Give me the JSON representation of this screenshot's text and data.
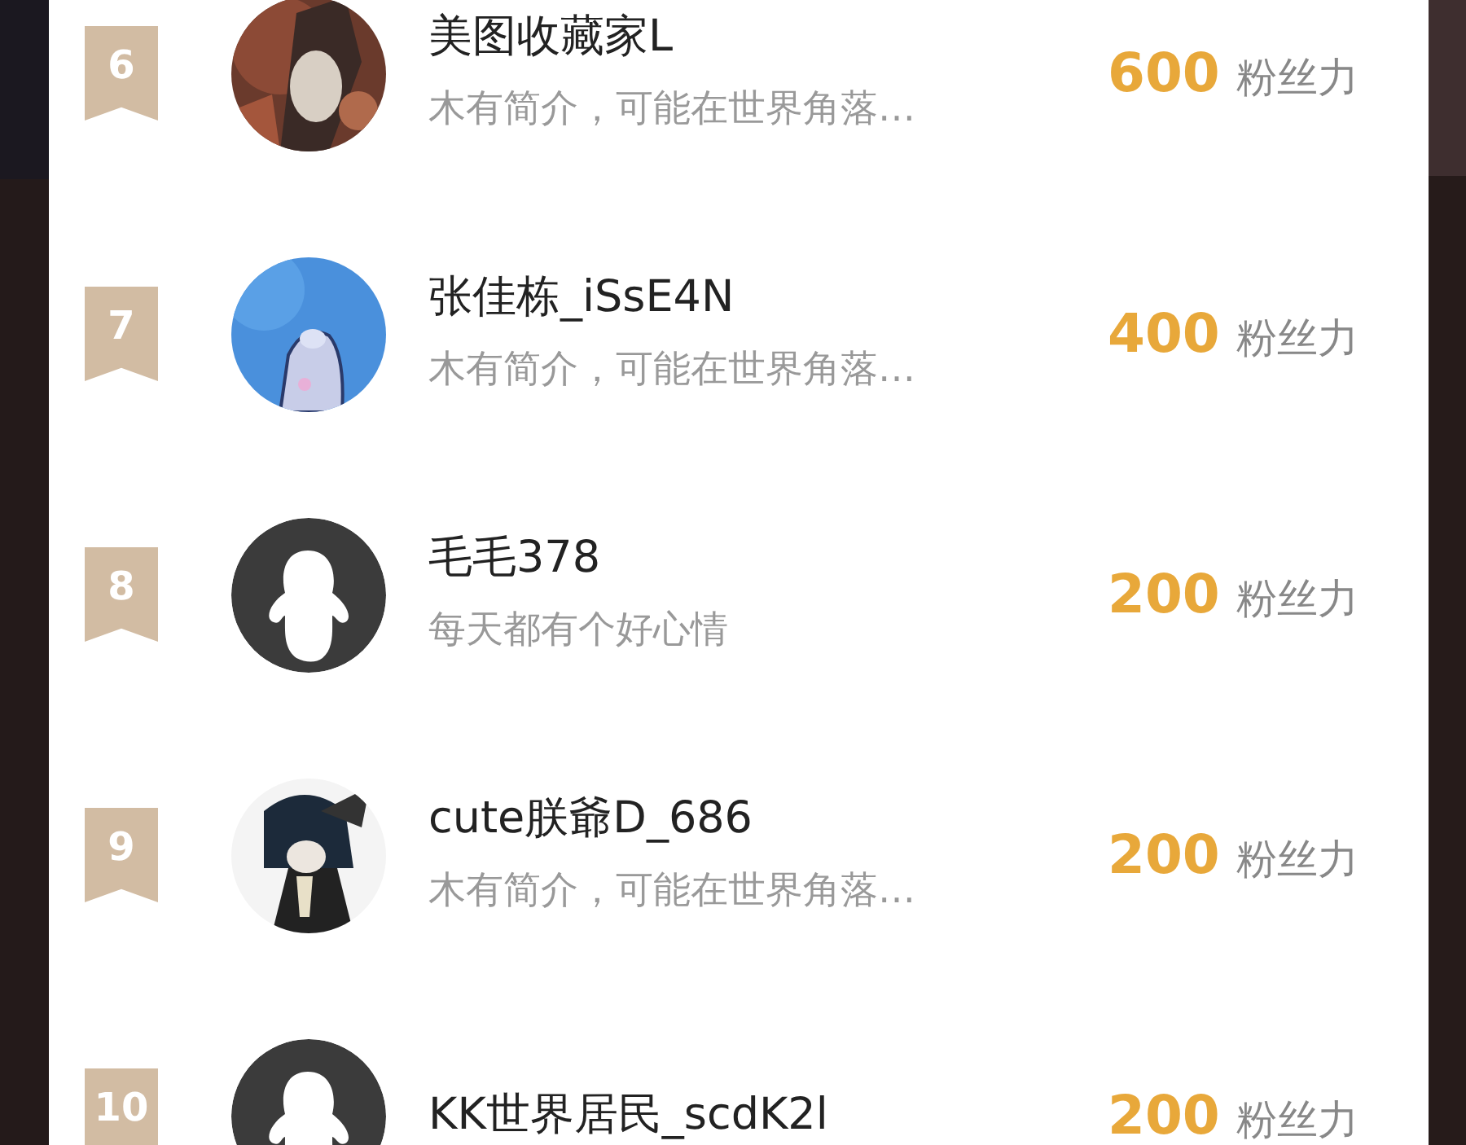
{
  "ranking": [
    {
      "rank": "6",
      "name": "美图收藏家L",
      "bio": "木有简介，可能在世界角落…",
      "score": "600",
      "score_unit": "粉丝力"
    },
    {
      "rank": "7",
      "name": "张佳栋_iSsE4N",
      "bio": "木有简介，可能在世界角落…",
      "score": "400",
      "score_unit": "粉丝力"
    },
    {
      "rank": "8",
      "avatar": {
        "kind": "default"
      },
      "name": "毛毛378",
      "bio": "每天都有个好心情",
      "score": "200",
      "score_unit": "粉丝力"
    },
    {
      "rank": "9",
      "name": "cute朕爺D_686",
      "bio": "木有简介，可能在世界角落…",
      "score": "200",
      "score_unit": "粉丝力"
    },
    {
      "rank": "10",
      "avatar": {
        "kind": "default"
      },
      "name": "KK世界居民_scdK2l",
      "score": "200",
      "score_unit": "粉丝力"
    }
  ]
}
